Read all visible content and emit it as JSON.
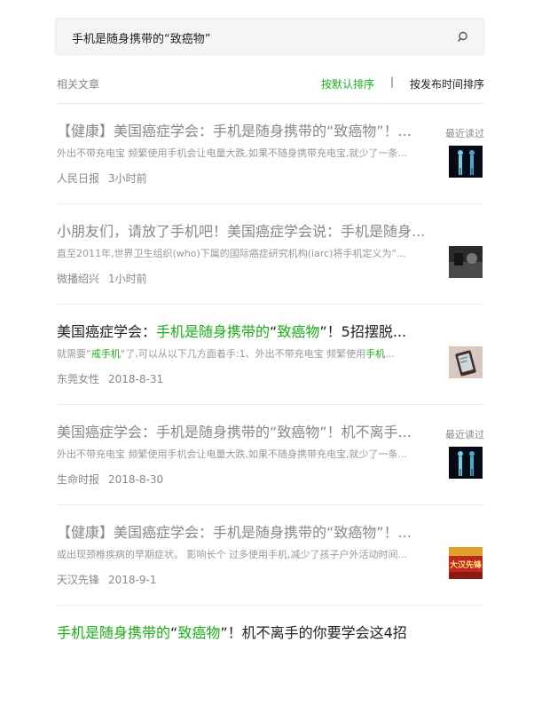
{
  "search": {
    "query": "手机是随身携带的“致癌物”"
  },
  "header": {
    "label": "相关文章",
    "sort_default": "按默认排序",
    "sort_separator": "|",
    "sort_time": "按发布时间排序"
  },
  "articles": [
    {
      "title_plain": "【健康】美国癌症学会：手机是随身携带的“致癌物”！...",
      "badge": "最近读过",
      "summary_plain": "外出不带充电宝 频繁使用手机会让电量大跌,如果不随身携带充电宝,就少了一条...",
      "source": "人民日报",
      "time": "3小时前",
      "thumb_icon": "figures-thumbnail"
    },
    {
      "title_plain": "小朋友们，请放了手机吧！美国癌症学会说：手机是随身...",
      "summary_plain": "直至2011年,世界卫生组织(who)下属的国际癌症研究机构(iarc)将手机定义为“...",
      "source": "微播绍兴",
      "time": "1小时前",
      "thumb_icon": "dark-photo-thumbnail"
    },
    {
      "title_a": "美国癌症学会：",
      "title_b": "手机是随身携带的",
      "title_c": "“",
      "title_d": "致癌物",
      "title_e": "”！5招摆脱...",
      "summary_a": "就需要“",
      "summary_b": "戒手机",
      "summary_c": "”了,可以从以下几方面着手:1、外出不带充电宝 频繁使用",
      "summary_d": "手机",
      "summary_e": "...",
      "source": "东莞女性",
      "time": "2018-8-31",
      "thumb_icon": "phone-photo-thumbnail"
    },
    {
      "title_plain": "美国癌症学会：手机是随身携带的“致癌物”！机不离手...",
      "badge": "最近读过",
      "summary_plain": "外出不带充电宝 频繁使用手机会让电量大跌,如果不随身携带充电宝,就少了一条...",
      "source": "生命时报",
      "time": "2018-8-30",
      "thumb_icon": "figures-thumbnail"
    },
    {
      "title_plain": "【健康】美国癌症学会：手机是随身携带的“致癌物”！...",
      "summary_plain": "或出现颈椎疾病的早期症状。 影响长个 过多使用手机,减少了孩子户外活动时间...",
      "source": "天汉先锋",
      "time": "2018-9-1",
      "thumb_icon": "poster-thumbnail",
      "thumb_text": "大汉先锋"
    },
    {
      "title_a": "手机是随身携带的",
      "title_b": "“",
      "title_c": "致癌物",
      "title_d": "”！机不离手的你要学会这4招"
    }
  ],
  "colors": {
    "highlight": "#1aad19",
    "read": "#888888"
  }
}
